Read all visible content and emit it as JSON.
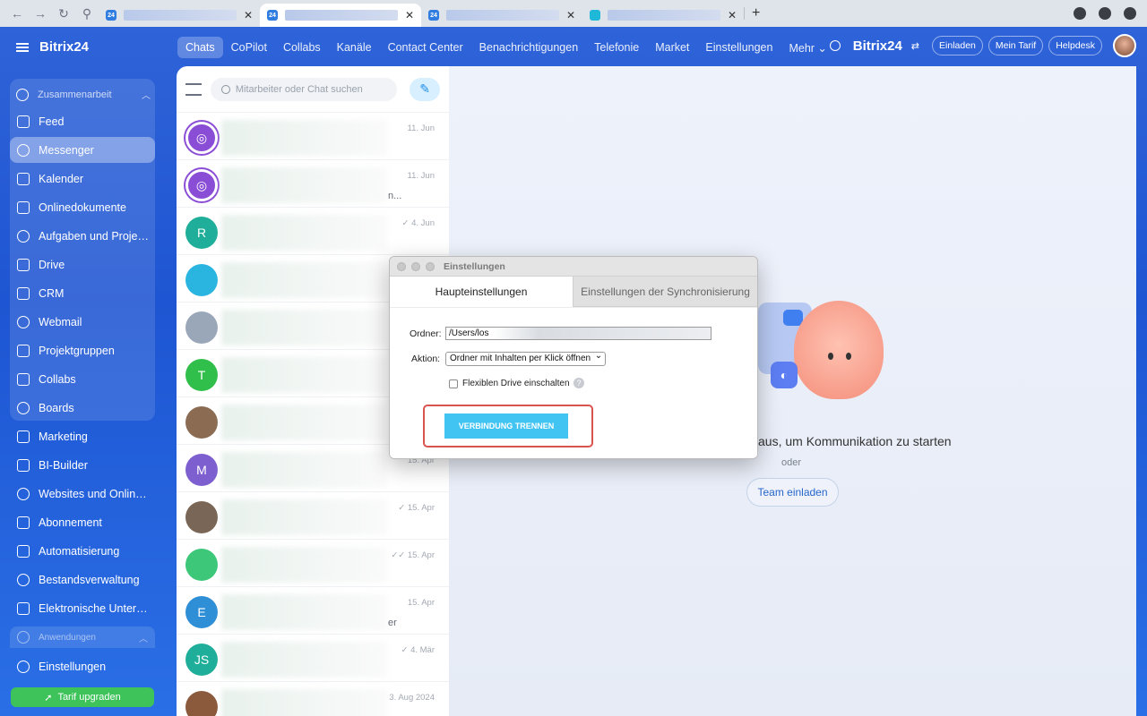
{
  "browser": {
    "tabs": [
      {
        "favicon": "24",
        "label": "",
        "active": false
      },
      {
        "favicon": "24",
        "label": "",
        "active": true
      },
      {
        "favicon": "24",
        "label": "",
        "active": false
      },
      {
        "favicon": "bitrix-drive-icon",
        "label": "",
        "active": false
      }
    ]
  },
  "sidebar": {
    "brand": "Bitrix24",
    "group_label": "Zusammenarbeit",
    "items": [
      {
        "label": "Feed",
        "icon": "feed-icon",
        "active": false
      },
      {
        "label": "Messenger",
        "icon": "messenger-icon",
        "active": true
      },
      {
        "label": "Kalender",
        "icon": "calendar-icon",
        "active": false
      },
      {
        "label": "Onlinedokumente",
        "icon": "documents-icon",
        "active": false
      },
      {
        "label": "Aufgaben und Projek...",
        "icon": "tasks-icon",
        "active": false
      },
      {
        "label": "Drive",
        "icon": "drive-icon",
        "active": false
      },
      {
        "label": "CRM",
        "icon": "crm-icon",
        "active": false
      },
      {
        "label": "Webmail",
        "icon": "mail-icon",
        "active": false
      },
      {
        "label": "Projektgruppen",
        "icon": "groups-icon",
        "active": false
      },
      {
        "label": "Collabs",
        "icon": "collabs-icon",
        "active": false
      },
      {
        "label": "Boards",
        "icon": "boards-icon",
        "active": false
      },
      {
        "label": "Marketing",
        "icon": "marketing-icon",
        "active": false
      },
      {
        "label": "BI-Builder",
        "icon": "bi-icon",
        "active": false
      },
      {
        "label": "Websites und Onlines...",
        "icon": "cart-icon",
        "active": false
      },
      {
        "label": "Abonnement",
        "icon": "subscription-icon",
        "active": false
      },
      {
        "label": "Automatisierung",
        "icon": "automation-icon",
        "active": false
      },
      {
        "label": "Bestandsverwaltung",
        "icon": "inventory-icon",
        "active": false
      },
      {
        "label": "Elektronische Untersc...",
        "icon": "signature-icon",
        "active": false
      }
    ],
    "apps_label": "Anwendungen",
    "settings_label": "Einstellungen",
    "upgrade_label": "Tarif upgraden"
  },
  "topmenu": {
    "items": [
      "Chats",
      "CoPilot",
      "Collabs",
      "Kanäle",
      "Contact Center",
      "Benachrichtigungen",
      "Telefonie",
      "Market",
      "Einstellungen",
      "Mehr ⌄"
    ],
    "active": "Chats",
    "brand": "Bitrix24",
    "invite": "Einladen",
    "plan": "Mein Tarif",
    "helpdesk": "Helpdesk"
  },
  "chats": {
    "search_placeholder": "Mitarbeiter oder Chat suchen",
    "rows": [
      {
        "avatar": "copilot",
        "initial": "",
        "color": "#8a4dd6",
        "date": "11. Jun",
        "snippet": ""
      },
      {
        "avatar": "copilot",
        "initial": "",
        "color": "#8a4dd6",
        "date": "11. Jun",
        "snippet": "n..."
      },
      {
        "avatar": "letter",
        "initial": "R",
        "color": "#1fae9a",
        "date": "✓ 4. Jun",
        "snippet": ""
      },
      {
        "avatar": "chat-bubble",
        "initial": "",
        "color": "#2ab5e0",
        "date": "",
        "snippet": ""
      },
      {
        "avatar": "cat-photo",
        "initial": "",
        "color": "#9aa7b8",
        "date": "",
        "snippet": ""
      },
      {
        "avatar": "letter",
        "initial": "T",
        "color": "#2fbf4a",
        "date": "",
        "snippet": ""
      },
      {
        "avatar": "photo",
        "initial": "",
        "color": "#8b6b52",
        "date": "",
        "snippet": ""
      },
      {
        "avatar": "letter",
        "initial": "M",
        "color": "#7d5fcf",
        "date": "15. Apr",
        "snippet": ""
      },
      {
        "avatar": "photo",
        "initial": "",
        "color": "#7a6656",
        "date": "✓ 15. Apr",
        "snippet": ""
      },
      {
        "avatar": "doc",
        "initial": "",
        "color": "#3cc779",
        "date": "✓✓ 15. Apr",
        "snippet": ""
      },
      {
        "avatar": "letter",
        "initial": "E",
        "color": "#2f8fd6",
        "date": "15. Apr",
        "snippet": "er"
      },
      {
        "avatar": "letter",
        "initial": "JS",
        "color": "#1fae9a",
        "date": "✓ 4. Mär",
        "snippet": ""
      },
      {
        "avatar": "photo",
        "initial": "",
        "color": "#8b5a3c",
        "date": "3. Aug 2024",
        "snippet": ""
      }
    ]
  },
  "main": {
    "empty_text": "aus, um Kommunikation zu starten",
    "or_text": "oder",
    "invite_button": "Team einladen"
  },
  "dialog": {
    "title": "Einstellungen",
    "tab_main": "Haupteinstellungen",
    "tab_sync": "Einstellungen der Synchronisierung",
    "folder_label": "Ordner:",
    "folder_value": "/Users/los",
    "action_label": "Aktion:",
    "action_value": "Ordner mit Inhalten per Klick öffnen",
    "checkbox_label": "Flexiblen Drive einschalten",
    "help": "?",
    "disconnect_button": "VERBINDUNG TRENNEN",
    "highlight_color": "#d9534f",
    "button_color": "#42c4f2"
  }
}
